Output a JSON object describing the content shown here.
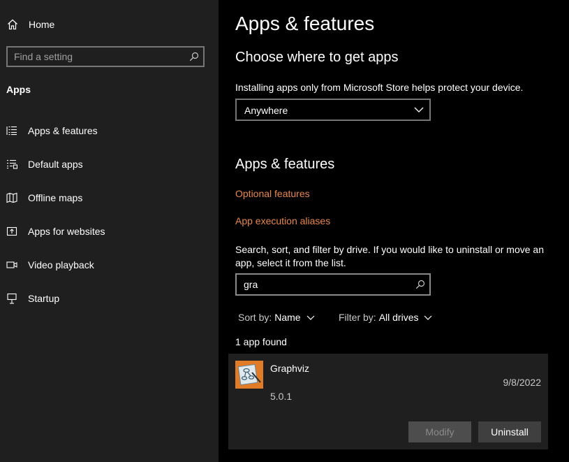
{
  "sidebar": {
    "home_label": "Home",
    "search_placeholder": "Find a setting",
    "section_title": "Apps",
    "items": [
      {
        "label": "Apps & features",
        "icon": "list-icon"
      },
      {
        "label": "Default apps",
        "icon": "default-list-icon"
      },
      {
        "label": "Offline maps",
        "icon": "map-icon"
      },
      {
        "label": "Apps for websites",
        "icon": "open-in-window-icon"
      },
      {
        "label": "Video playback",
        "icon": "video-icon"
      },
      {
        "label": "Startup",
        "icon": "startup-icon"
      }
    ]
  },
  "main": {
    "title": "Apps & features",
    "choose_heading": "Choose where to get apps",
    "choose_desc": "Installing apps only from Microsoft Store helps protect your device.",
    "source_dropdown_value": "Anywhere",
    "features_heading": "Apps & features",
    "optional_features_link": "Optional features",
    "aliases_link": "App execution aliases",
    "search_desc": "Search, sort, and filter by drive. If you would like to uninstall or move an app, select it from the list.",
    "search_value": "gra",
    "sort_label": "Sort by:",
    "sort_value": "Name",
    "filter_label": "Filter by:",
    "filter_value": "All drives",
    "result_count": "1 app found",
    "app": {
      "name": "Graphviz",
      "date": "9/8/2022",
      "version": "5.0.1",
      "modify_label": "Modify",
      "uninstall_label": "Uninstall"
    }
  },
  "colors": {
    "accent_link": "#e8874a",
    "sidebar_bg": "#1f1f1f",
    "main_bg": "#000000",
    "app_icon_bg": "#e07b28"
  }
}
